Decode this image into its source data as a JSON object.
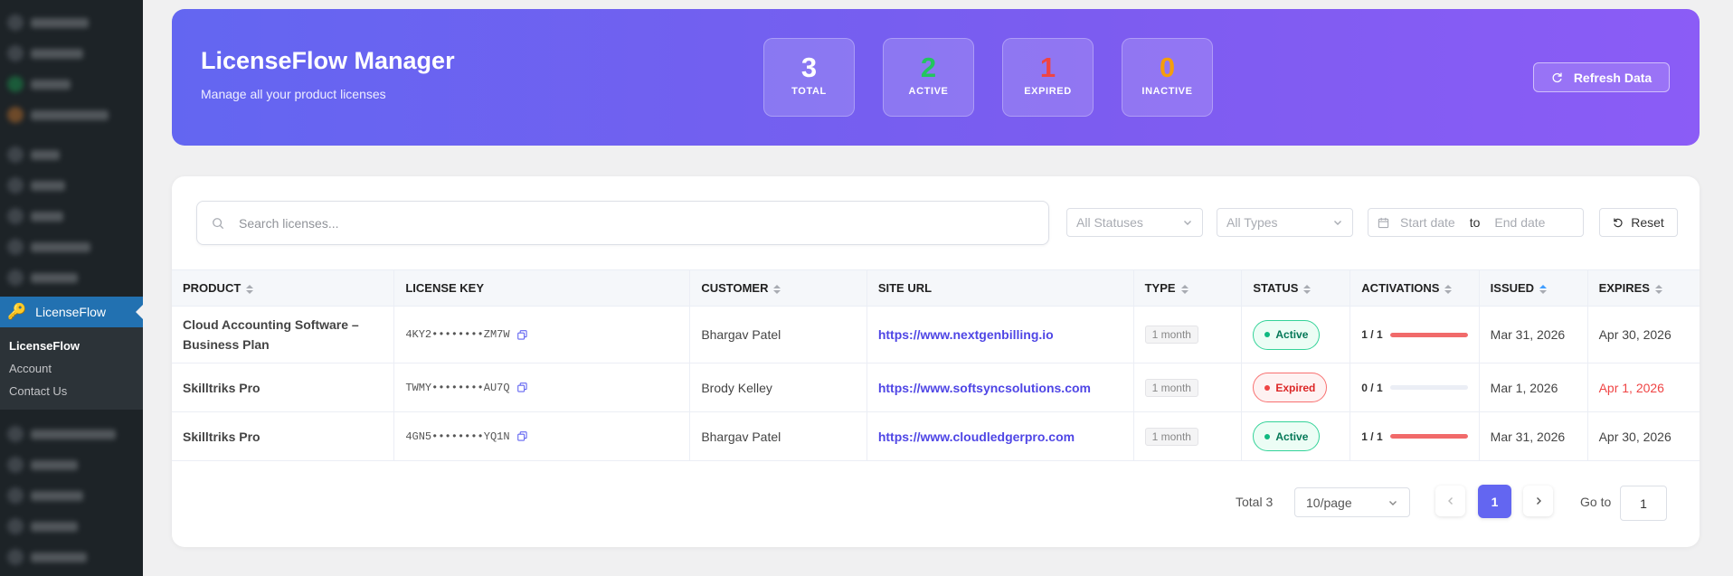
{
  "sidebar": {
    "active_label": "LicenseFlow",
    "submenu": [
      "LicenseFlow",
      "Account",
      "Contact Us"
    ]
  },
  "header": {
    "title": "LicenseFlow Manager",
    "subtitle": "Manage all your product licenses",
    "refresh_label": "Refresh Data",
    "stats": [
      {
        "value": "3",
        "label": "TOTAL",
        "color": "#ffffff"
      },
      {
        "value": "2",
        "label": "ACTIVE",
        "color": "#22c55e"
      },
      {
        "value": "1",
        "label": "EXPIRED",
        "color": "#ef4444"
      },
      {
        "value": "0",
        "label": "INACTIVE",
        "color": "#f59e0b"
      }
    ]
  },
  "filters": {
    "search_placeholder": "Search licenses...",
    "status_placeholder": "All Statuses",
    "type_placeholder": "All Types",
    "start_placeholder": "Start date",
    "range_separator": "to",
    "end_placeholder": "End date",
    "reset_label": "Reset"
  },
  "table": {
    "columns": [
      "PRODUCT",
      "LICENSE KEY",
      "CUSTOMER",
      "SITE URL",
      "TYPE",
      "STATUS",
      "ACTIVATIONS",
      "ISSUED",
      "EXPIRES"
    ],
    "rows": [
      {
        "product_line1": "Cloud Accounting Software –",
        "product_line2": "Business Plan",
        "key": "4KY2••••••••ZM7W",
        "customer": "Bhargav Patel",
        "url": "https://www.nextgenbilling.io",
        "type": "1 month",
        "status": "Active",
        "activations": "1 / 1",
        "activation_ratio": 1,
        "issued": "Mar 31, 2026",
        "expires": "Apr 30, 2026"
      },
      {
        "product_line1": "Skilltriks Pro",
        "product_line2": "",
        "key": "TWMY••••••••AU7Q",
        "customer": "Brody Kelley",
        "url": "https://www.softsyncsolutions.com",
        "type": "1 month",
        "status": "Expired",
        "activations": "0 / 1",
        "activation_ratio": 0,
        "issued": "Mar 1, 2026",
        "expires": "Apr 1, 2026"
      },
      {
        "product_line1": "Skilltriks Pro",
        "product_line2": "",
        "key": "4GN5••••••••YQ1N",
        "customer": "Bhargav Patel",
        "url": "https://www.cloudledgerpro.com",
        "type": "1 month",
        "status": "Active",
        "activations": "1 / 1",
        "activation_ratio": 1,
        "issued": "Mar 31, 2026",
        "expires": "Apr 30, 2026"
      }
    ]
  },
  "pagination": {
    "total_label": "Total 3",
    "page_size": "10/page",
    "current_page": "1",
    "goto_label": "Go to",
    "goto_value": "1"
  },
  "colors": {
    "accent": "#6366f1",
    "active": "#10b981",
    "expired": "#ef4444"
  }
}
